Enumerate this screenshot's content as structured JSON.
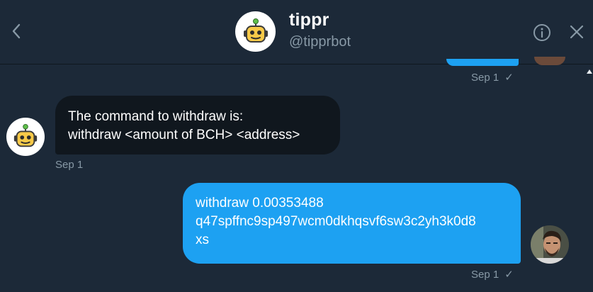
{
  "header": {
    "name": "tippr",
    "handle": "@tipprbot",
    "back_icon": "chevron-left-icon",
    "info_icon": "info-icon",
    "close_icon": "close-icon"
  },
  "messages": [
    {
      "direction": "outgoing",
      "partial": true,
      "date": "Sep 1",
      "status_icon": "check-icon",
      "status": "✓"
    },
    {
      "direction": "incoming",
      "lines": [
        "The command to withdraw is:",
        "withdraw <amount of BCH> <address>"
      ],
      "date": "Sep 1"
    },
    {
      "direction": "outgoing",
      "lines": [
        "withdraw 0.00353488",
        "q47spffnc9sp497wcm0dkhqsvf6sw3c2yh3k0d8",
        "xs"
      ],
      "date": "Sep 1",
      "status_icon": "check-icon",
      "status": "✓"
    }
  ],
  "colors": {
    "background": "#1c2938",
    "incoming_bubble": "#10171e",
    "outgoing_bubble": "#1da1f2",
    "secondary_text": "#8899a6"
  }
}
